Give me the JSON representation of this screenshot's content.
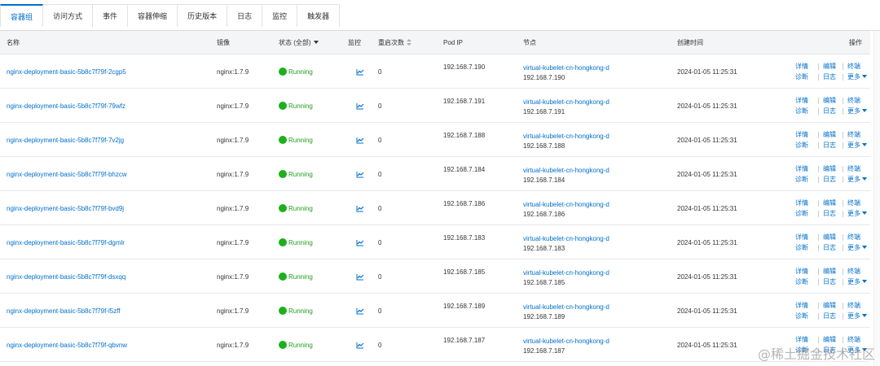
{
  "tabs": [
    "容器组",
    "访问方式",
    "事件",
    "容器伸缩",
    "历史版本",
    "日志",
    "监控",
    "触发器"
  ],
  "columns": {
    "name": "名称",
    "image": "镜像",
    "status": "状态 (全部)",
    "monitor": "监控",
    "restarts": "重启次数",
    "pod_ip": "Pod IP",
    "node": "节点",
    "created": "创建时间",
    "ops": "操作"
  },
  "ops": {
    "detail": "详情",
    "edit": "编辑",
    "terminal": "终端",
    "diagnose": "诊断",
    "logs": "日志",
    "more": "更多"
  },
  "rows": [
    {
      "name": "nginx-deployment-basic-5b8c7f79f-2cgp5",
      "image": "nginx:1.7.9",
      "status": "Running",
      "restarts": "0",
      "pod_ip": "192.168.7.190",
      "node": "virtual-kubelet-cn-hongkong-d",
      "node_ip": "192.168.7.190",
      "created": "2024-01-05 11:25:31"
    },
    {
      "name": "nginx-deployment-basic-5b8c7f79f-79wfz",
      "image": "nginx:1.7.9",
      "status": "Running",
      "restarts": "0",
      "pod_ip": "192.168.7.191",
      "node": "virtual-kubelet-cn-hongkong-d",
      "node_ip": "192.168.7.191",
      "created": "2024-01-05 11:25:31"
    },
    {
      "name": "nginx-deployment-basic-5b8c7f79f-7v2jg",
      "image": "nginx:1.7.9",
      "status": "Running",
      "restarts": "0",
      "pod_ip": "192.168.7.188",
      "node": "virtual-kubelet-cn-hongkong-d",
      "node_ip": "192.168.7.188",
      "created": "2024-01-05 11:25:31"
    },
    {
      "name": "nginx-deployment-basic-5b8c7f79f-bhzcw",
      "image": "nginx:1.7.9",
      "status": "Running",
      "restarts": "0",
      "pod_ip": "192.168.7.184",
      "node": "virtual-kubelet-cn-hongkong-d",
      "node_ip": "192.168.7.184",
      "created": "2024-01-05 11:25:31"
    },
    {
      "name": "nginx-deployment-basic-5b8c7f79f-bvd9j",
      "image": "nginx:1.7.9",
      "status": "Running",
      "restarts": "0",
      "pod_ip": "192.168.7.186",
      "node": "virtual-kubelet-cn-hongkong-d",
      "node_ip": "192.168.7.186",
      "created": "2024-01-05 11:25:31"
    },
    {
      "name": "nginx-deployment-basic-5b8c7f79f-dgmlr",
      "image": "nginx:1.7.9",
      "status": "Running",
      "restarts": "0",
      "pod_ip": "192.168.7.183",
      "node": "virtual-kubelet-cn-hongkong-d",
      "node_ip": "192.168.7.183",
      "created": "2024-01-05 11:25:31"
    },
    {
      "name": "nginx-deployment-basic-5b8c7f79f-dsxqq",
      "image": "nginx:1.7.9",
      "status": "Running",
      "restarts": "0",
      "pod_ip": "192.168.7.185",
      "node": "virtual-kubelet-cn-hongkong-d",
      "node_ip": "192.168.7.185",
      "created": "2024-01-05 11:25:31"
    },
    {
      "name": "nginx-deployment-basic-5b8c7f79f-l5zff",
      "image": "nginx:1.7.9",
      "status": "Running",
      "restarts": "0",
      "pod_ip": "192.168.7.189",
      "node": "virtual-kubelet-cn-hongkong-d",
      "node_ip": "192.168.7.189",
      "created": "2024-01-05 11:25:31"
    },
    {
      "name": "nginx-deployment-basic-5b8c7f79f-qbvnw",
      "image": "nginx:1.7.9",
      "status": "Running",
      "restarts": "0",
      "pod_ip": "192.168.7.187",
      "node": "virtual-kubelet-cn-hongkong-d",
      "node_ip": "192.168.7.187",
      "created": "2024-01-05 11:25:31"
    }
  ],
  "watermark": "@稀土掘金技术社区",
  "colors": {
    "accent": "#0070cc",
    "running": "#1db01d"
  }
}
